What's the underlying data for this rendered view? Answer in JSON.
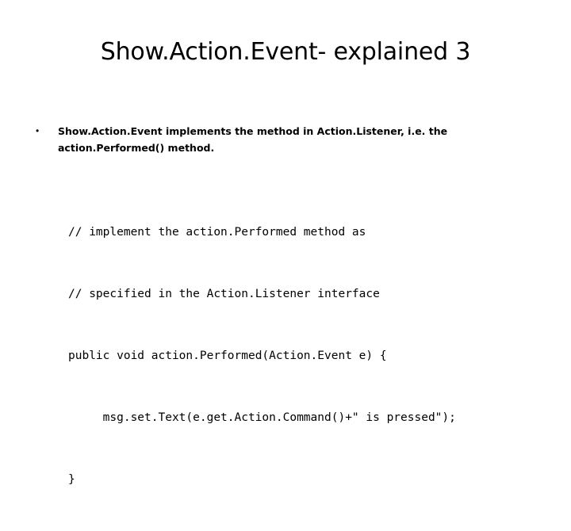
{
  "slide": {
    "title": "Show.Action.Event- explained 3",
    "bullets": [
      {
        "marker": "•",
        "text": "Show.Action.Event implements the method in Action.Listener, i.e. the action.Performed() method."
      }
    ],
    "code": {
      "lines": [
        "// implement the action.Performed method as",
        "// specified in the Action.Listener interface",
        "public void action.Performed(Action.Event e) {",
        "     msg.set.Text(e.get.Action.Command()+\" is pressed\");",
        "}"
      ]
    },
    "colors": {
      "background": "#ffffff",
      "text": "#000000"
    }
  }
}
